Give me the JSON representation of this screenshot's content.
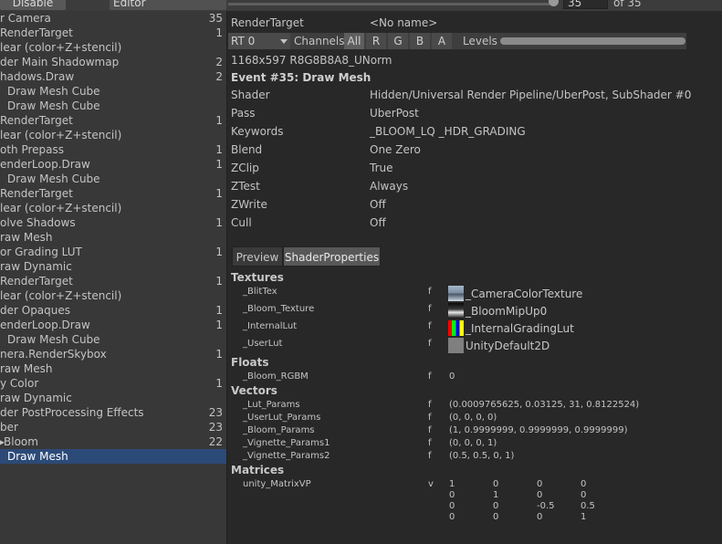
{
  "toolbar": {
    "disable_label": "Disable",
    "editor_label": "Editor",
    "event_value": "35",
    "of_label": "of 35"
  },
  "event_list": [
    {
      "label": "r Camera",
      "count": "35",
      "selected": false
    },
    {
      "label": "RenderTarget",
      "count": "1",
      "selected": false
    },
    {
      "label": "lear (color+Z+stencil)",
      "count": "",
      "selected": false
    },
    {
      "label": "der Main Shadowmap",
      "count": "2",
      "selected": false
    },
    {
      "label": "hadows.Draw",
      "count": "2",
      "selected": false
    },
    {
      "label": "Draw Mesh Cube",
      "count": "",
      "selected": false
    },
    {
      "label": "Draw Mesh Cube",
      "count": "",
      "selected": false
    },
    {
      "label": "RenderTarget",
      "count": "1",
      "selected": false
    },
    {
      "label": "lear (color+Z+stencil)",
      "count": "",
      "selected": false
    },
    {
      "label": "oth Prepass",
      "count": "1",
      "selected": false
    },
    {
      "label": "enderLoop.Draw",
      "count": "1",
      "selected": false
    },
    {
      "label": "Draw Mesh Cube",
      "count": "",
      "selected": false
    },
    {
      "label": "RenderTarget",
      "count": "1",
      "selected": false
    },
    {
      "label": "lear (color+Z+stencil)",
      "count": "",
      "selected": false
    },
    {
      "label": "olve Shadows",
      "count": "1",
      "selected": false
    },
    {
      "label": "raw Mesh",
      "count": "",
      "selected": false
    },
    {
      "label": "or Grading LUT",
      "count": "1",
      "selected": false
    },
    {
      "label": "raw Dynamic",
      "count": "",
      "selected": false
    },
    {
      "label": "RenderTarget",
      "count": "1",
      "selected": false
    },
    {
      "label": "lear (color+Z+stencil)",
      "count": "",
      "selected": false
    },
    {
      "label": "der Opaques",
      "count": "1",
      "selected": false
    },
    {
      "label": "enderLoop.Draw",
      "count": "1",
      "selected": false
    },
    {
      "label": "Draw Mesh Cube",
      "count": "",
      "selected": false
    },
    {
      "label": "nera.RenderSkybox",
      "count": "1",
      "selected": false
    },
    {
      "label": "raw Mesh",
      "count": "",
      "selected": false
    },
    {
      "label": "y Color",
      "count": "1",
      "selected": false
    },
    {
      "label": "raw Dynamic",
      "count": "",
      "selected": false
    },
    {
      "label": "der PostProcessing Effects",
      "count": "23",
      "selected": false
    },
    {
      "label": "ber",
      "count": "23",
      "selected": false
    },
    {
      "label": "Bloom",
      "count": "22",
      "selected": false
    },
    {
      "label": "Draw Mesh",
      "count": "",
      "selected": true
    }
  ],
  "render_target": {
    "label": "RenderTarget",
    "value": "<No name>"
  },
  "rt_toolbar": {
    "rt_select": "RT 0",
    "channels_label": "Channels",
    "all": "All",
    "r": "R",
    "g": "G",
    "b": "B",
    "a": "A",
    "levels_label": "Levels"
  },
  "format": "1168x597 R8G8B8A8_UNorm",
  "event_title": "Event #35: Draw Mesh",
  "properties": [
    {
      "label": "Shader",
      "value": "Hidden/Universal Render Pipeline/UberPost, SubShader #0"
    },
    {
      "label": "Pass",
      "value": "UberPost"
    },
    {
      "label": "Keywords",
      "value": "_BLOOM_LQ _HDR_GRADING"
    },
    {
      "label": "Blend",
      "value": "One Zero"
    },
    {
      "label": "ZClip",
      "value": "True"
    },
    {
      "label": "ZTest",
      "value": "Always"
    },
    {
      "label": "ZWrite",
      "value": "Off"
    },
    {
      "label": "Cull",
      "value": "Off"
    }
  ],
  "tabs": {
    "preview": "Preview",
    "shader_properties": "ShaderProperties"
  },
  "textures": {
    "heading": "Textures",
    "items": [
      {
        "name": "_BlitTex",
        "stage": "f",
        "texture": "_CameraColorTexture"
      },
      {
        "name": "_Bloom_Texture",
        "stage": "f",
        "texture": "_BloomMipUp0"
      },
      {
        "name": "_InternalLut",
        "stage": "f",
        "texture": "_InternalGradingLut"
      },
      {
        "name": "_UserLut",
        "stage": "f",
        "texture": "UnityDefault2D"
      }
    ]
  },
  "floats": {
    "heading": "Floats",
    "items": [
      {
        "name": "_Bloom_RGBM",
        "stage": "f",
        "value": "0"
      }
    ]
  },
  "vectors": {
    "heading": "Vectors",
    "items": [
      {
        "name": "_Lut_Params",
        "stage": "f",
        "value": "(0.0009765625, 0.03125, 31, 0.8122524)"
      },
      {
        "name": "_UserLut_Params",
        "stage": "f",
        "value": "(0, 0, 0, 0)"
      },
      {
        "name": "_Bloom_Params",
        "stage": "f",
        "value": "(1, 0.9999999, 0.9999999, 0.9999999)"
      },
      {
        "name": "_Vignette_Params1",
        "stage": "f",
        "value": "(0, 0, 0, 1)"
      },
      {
        "name": "_Vignette_Params2",
        "stage": "f",
        "value": "(0.5, 0.5, 0, 1)"
      }
    ]
  },
  "matrices": {
    "heading": "Matrices",
    "name": "unity_MatrixVP",
    "stage": "v",
    "rows": [
      [
        "1",
        "0",
        "0",
        "0"
      ],
      [
        "0",
        "1",
        "0",
        "0"
      ],
      [
        "0",
        "0",
        "-0.5",
        "0.5"
      ],
      [
        "0",
        "0",
        "0",
        "1"
      ]
    ]
  },
  "colors": {
    "selection": "#2c4a78",
    "panel": "#383838",
    "background": "#282828"
  }
}
